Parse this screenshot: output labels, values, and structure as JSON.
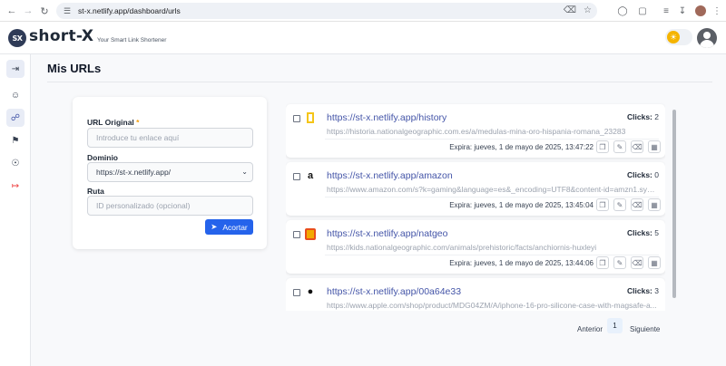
{
  "browser": {
    "url": "st-x.netlify.app/dashboard/urls"
  },
  "app": {
    "logo_mark": "SX",
    "name": "short-X",
    "tagline": "Your Smart Link Shortener"
  },
  "page": {
    "title": "Mis URLs"
  },
  "form": {
    "url_label": "URL Original",
    "required_mark": "*",
    "url_placeholder": "Introduce tu enlace aquí",
    "domain_label": "Dominio",
    "domain_value": "https://st-x.netlify.app/",
    "path_label": "Ruta",
    "path_placeholder": "ID personalizado (opcional)",
    "submit_label": "Acortar"
  },
  "urls": [
    {
      "short": "https://st-x.netlify.app/history",
      "original": "https://historia.nationalgeographic.com.es/a/medulas-mina-oro-hispania-romana_23283",
      "clicks_label": "Clicks:",
      "clicks": "2",
      "expires": "Expira: jueves, 1 de mayo de 2025, 13:47:22",
      "favicon": "natgeo-icon"
    },
    {
      "short": "https://st-x.netlify.app/amazon",
      "original": "https://www.amazon.com/s?k=gaming&language=es&_encoding=UTF8&content-id=amzn1.sym...",
      "clicks_label": "Clicks:",
      "clicks": "0",
      "expires": "Expira: jueves, 1 de mayo de 2025, 13:45:04",
      "favicon": "amazon-icon"
    },
    {
      "short": "https://st-x.netlify.app/natgeo",
      "original": "https://kids.nationalgeographic.com/animals/prehistoric/facts/anchiornis-huxleyi",
      "clicks_label": "Clicks:",
      "clicks": "5",
      "expires": "Expira: jueves, 1 de mayo de 2025, 13:44:06",
      "favicon": "natgeo-kids-icon"
    },
    {
      "short": "https://st-x.netlify.app/00a64e33",
      "original": "https://www.apple.com/shop/product/MDG04ZM/A/iphone-16-pro-silicone-case-with-magsafe-a...",
      "clicks_label": "Clicks:",
      "clicks": "3",
      "expires": "",
      "favicon": "apple-icon"
    }
  ],
  "pagination": {
    "prev": "Anterior",
    "current": "1",
    "next": "Siguiente"
  },
  "colors": {
    "primary": "#2563eb",
    "link": "#4455a8",
    "danger": "#ef4444",
    "toggle_sun": "#f5b400"
  }
}
